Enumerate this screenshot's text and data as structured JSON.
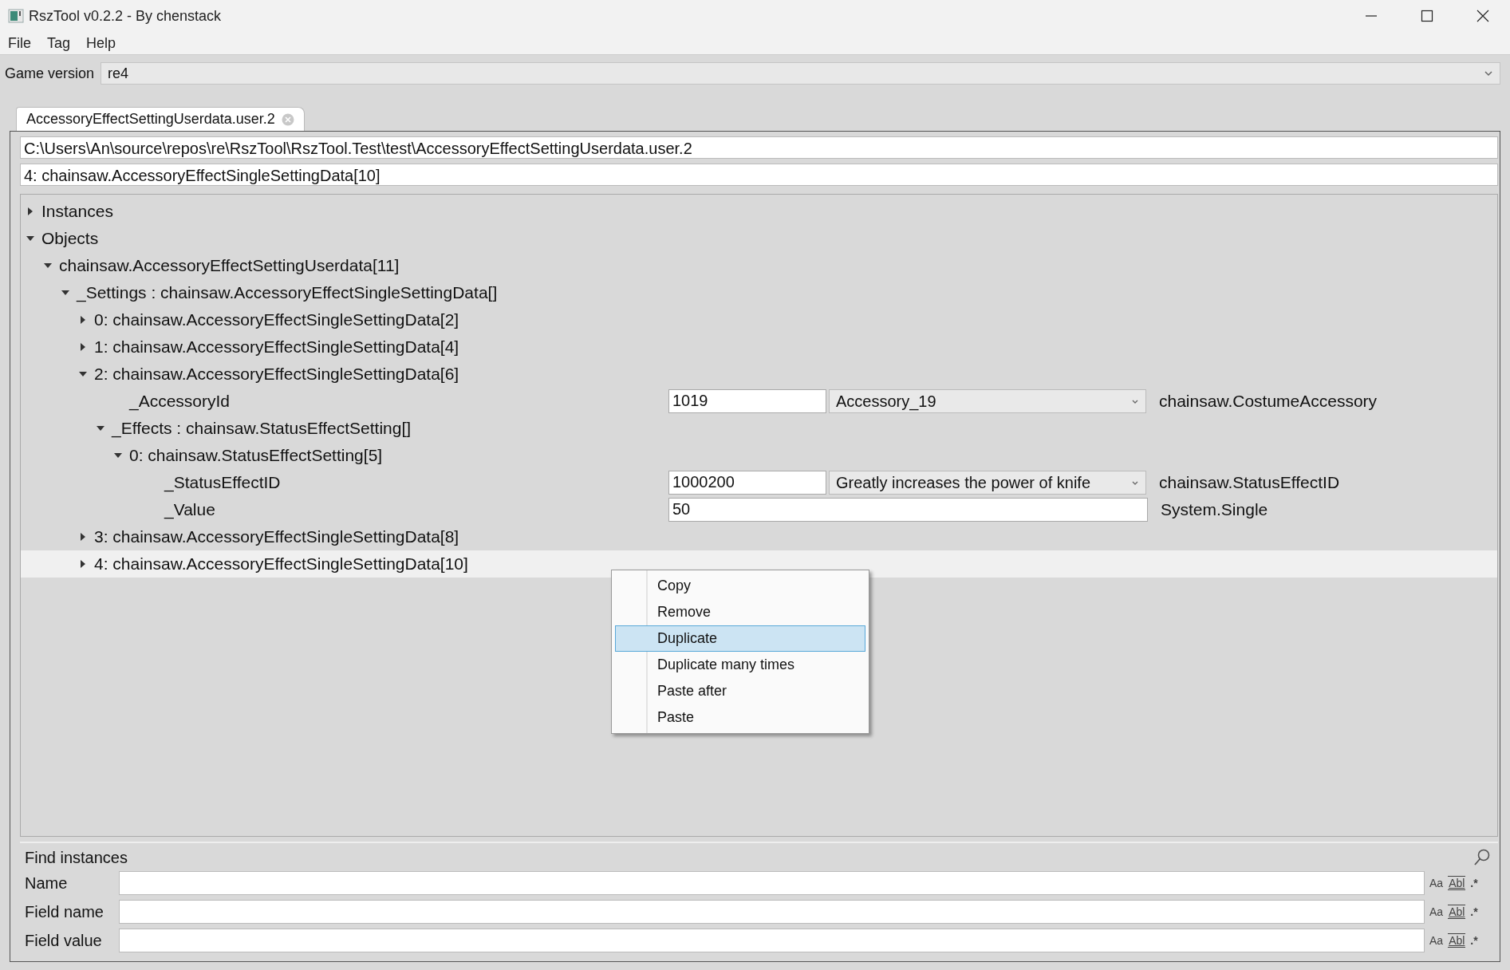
{
  "window": {
    "title": "RszTool v0.2.2 - By chenstack"
  },
  "menu": [
    "File",
    "Tag",
    "Help"
  ],
  "game_version": {
    "label": "Game version",
    "value": "re4"
  },
  "tabs": [
    {
      "label": "AccessoryEffectSettingUserdata.user.2",
      "selected": true
    }
  ],
  "path_field": {
    "value": "C:\\Users\\An\\source\\repos\\re\\RszTool\\RszTool.Test\\test\\AccessoryEffectSettingUserdata.user.2"
  },
  "selection_field": {
    "value": "4: chainsaw.AccessoryEffectSingleSettingData[10]"
  },
  "tree": [
    {
      "label": "Instances",
      "expanded": false,
      "selected": false
    },
    {
      "label": "Objects",
      "expanded": true,
      "selected": false,
      "children": [
        {
          "label": "chainsaw.AccessoryEffectSettingUserdata[11]",
          "expanded": true,
          "selected": false,
          "children": [
            {
              "label": "_Settings : chainsaw.AccessoryEffectSingleSettingData[]",
              "expanded": true,
              "selected": false,
              "children": [
                {
                  "label": "0: chainsaw.AccessoryEffectSingleSettingData[2]",
                  "expanded": false,
                  "selected": false
                },
                {
                  "label": "1: chainsaw.AccessoryEffectSingleSettingData[4]",
                  "expanded": false,
                  "selected": false
                },
                {
                  "label": "2: chainsaw.AccessoryEffectSingleSettingData[6]",
                  "expanded": true,
                  "selected": false,
                  "children": [
                    {
                      "kind": "field",
                      "label": "_AccessoryId",
                      "value": "1019",
                      "option": "Accessory_19",
                      "type": "chainsaw.CostumeAccessory",
                      "selected": false
                    },
                    {
                      "label": "_Effects : chainsaw.StatusEffectSetting[]",
                      "expanded": true,
                      "selected": false,
                      "children": [
                        {
                          "label": "0: chainsaw.StatusEffectSetting[5]",
                          "expanded": true,
                          "selected": false,
                          "children": [
                            {
                              "kind": "field",
                              "label": "_StatusEffectID",
                              "value": "1000200",
                              "option": "Greatly increases the power of knife",
                              "type": "chainsaw.StatusEffectID",
                              "selected": false
                            },
                            {
                              "kind": "field",
                              "label": "_Value",
                              "value": "50",
                              "type": "System.Single",
                              "selected": false
                            }
                          ]
                        }
                      ]
                    }
                  ]
                },
                {
                  "label": "3: chainsaw.AccessoryEffectSingleSettingData[8]",
                  "expanded": false,
                  "selected": false
                },
                {
                  "label": "4: chainsaw.AccessoryEffectSingleSettingData[10]",
                  "expanded": false,
                  "selected": true
                }
              ]
            }
          ]
        }
      ]
    }
  ],
  "context_menu": [
    {
      "label": "Copy",
      "selected": false
    },
    {
      "label": "Remove",
      "selected": false
    },
    {
      "label": "Duplicate",
      "selected": true
    },
    {
      "label": "Duplicate many times",
      "selected": false
    },
    {
      "label": "Paste after",
      "selected": false
    },
    {
      "label": "Paste",
      "selected": false
    }
  ],
  "find": {
    "title": "Find instances",
    "rows": [
      {
        "label": "Name",
        "options": [
          "Aa",
          "Abl",
          ".*"
        ]
      },
      {
        "label": "Field name",
        "options": [
          "Aa",
          "Abl",
          ".*"
        ]
      },
      {
        "label": "Field value",
        "options": [
          "Aa",
          "Abl",
          ".*"
        ]
      }
    ]
  }
}
